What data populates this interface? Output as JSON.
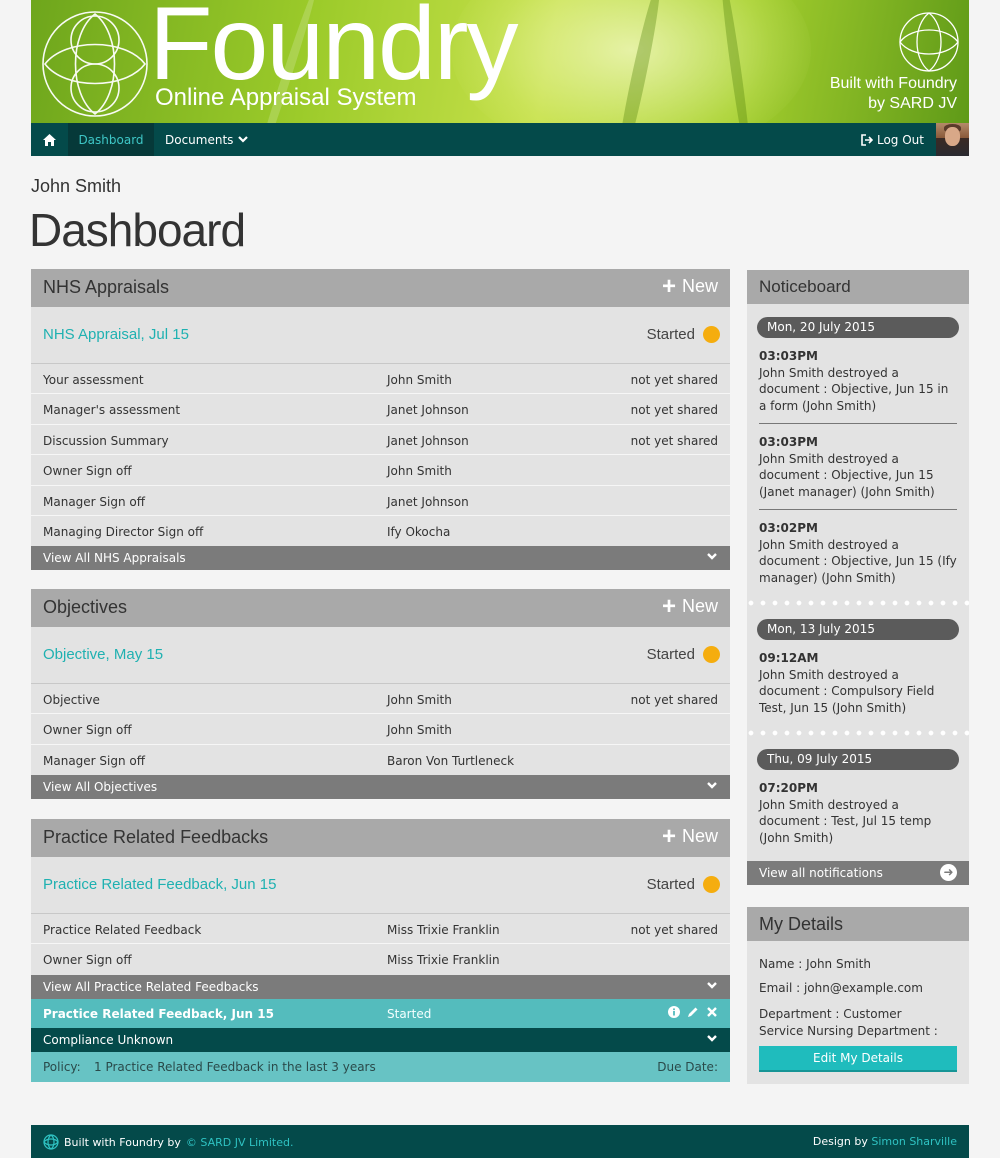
{
  "header": {
    "brand_title": "Foundry",
    "brand_subtitle": "Online Appraisal System",
    "built_with_line1": "Built with Foundry",
    "built_with_line2": "by SARD JV"
  },
  "nav": {
    "home_icon": "home-icon",
    "dashboard": "Dashboard",
    "documents": "Documents",
    "logout": "Log Out"
  },
  "page": {
    "user_name": "John Smith",
    "title": "Dashboard"
  },
  "status_color": "#f5ad0f",
  "accent_color": "#1fb1b1",
  "panels": {
    "nhs": {
      "title": "NHS Appraisals",
      "new_label": "New",
      "item_title": "NHS Appraisal, Jul 15",
      "item_status": "Started",
      "rows": [
        {
          "name": "Your assessment",
          "person": "John Smith",
          "state": "not yet shared"
        },
        {
          "name": "Manager's assessment",
          "person": "Janet Johnson",
          "state": "not yet shared"
        },
        {
          "name": "Discussion Summary",
          "person": "Janet Johnson",
          "state": "not yet shared"
        },
        {
          "name": "Owner Sign off",
          "person": "John Smith",
          "state": ""
        },
        {
          "name": "Manager Sign off",
          "person": "Janet Johnson",
          "state": ""
        },
        {
          "name": "Managing Director Sign off",
          "person": "Ify Okocha",
          "state": ""
        }
      ],
      "view_all": "View All NHS Appraisals"
    },
    "objectives": {
      "title": "Objectives",
      "new_label": "New",
      "item_title": "Objective, May 15",
      "item_status": "Started",
      "rows": [
        {
          "name": "Objective",
          "person": "John Smith",
          "state": "not yet shared"
        },
        {
          "name": "Owner Sign off",
          "person": "John Smith",
          "state": ""
        },
        {
          "name": "Manager Sign off",
          "person": "Baron Von Turtleneck",
          "state": ""
        }
      ],
      "view_all": "View All Objectives"
    },
    "feedback": {
      "title": "Practice Related Feedbacks",
      "new_label": "New",
      "item_title": "Practice Related Feedback, Jun 15",
      "item_status": "Started",
      "rows": [
        {
          "name": "Practice Related Feedback",
          "person": "Miss Trixie Franklin",
          "state": "not yet shared"
        },
        {
          "name": "Owner Sign off",
          "person": "Miss Trixie Franklin",
          "state": ""
        }
      ],
      "view_all": "View All Practice Related Feedbacks",
      "highlight": {
        "title": "Practice Related Feedback, Jun 15",
        "status": "Started"
      },
      "compliance": "Compliance Unknown",
      "policy_label": "Policy:",
      "policy_value": "1 Practice Related Feedback in the last 3 years",
      "due_label": "Due Date:"
    }
  },
  "noticeboard": {
    "title": "Noticeboard",
    "groups": [
      {
        "date": "Mon, 20 July 2015",
        "items": [
          {
            "time": "03:03PM",
            "text": "John Smith destroyed a document : Objective, Jun 15 in a form (John Smith)"
          },
          {
            "time": "03:03PM",
            "text": "John Smith destroyed a document : Objective, Jun 15 (Janet manager) (John Smith)"
          },
          {
            "time": "03:02PM",
            "text": "John Smith destroyed a document : Objective, Jun 15 (Ify manager) (John Smith)"
          }
        ]
      },
      {
        "date": "Mon, 13 July 2015",
        "items": [
          {
            "time": "09:12AM",
            "text": "John Smith destroyed a document : Compulsory Field Test, Jun 15 (John Smith)"
          }
        ]
      },
      {
        "date": "Thu, 09 July 2015",
        "items": [
          {
            "time": "07:20PM",
            "text": "John Smith destroyed a document : Test, Jul 15 temp (John Smith)"
          }
        ]
      }
    ],
    "view_all": "View all notifications"
  },
  "my_details": {
    "title": "My Details",
    "name": "Name : John Smith",
    "email": "Email : john@example.com",
    "department": "Department : Customer Service Nursing Department :",
    "edit_button": "Edit My Details"
  },
  "footer": {
    "built_with": "Built with Foundry by",
    "company": "© SARD JV Limited.",
    "design_by": "Design by",
    "designer": "Simon Sharville"
  }
}
